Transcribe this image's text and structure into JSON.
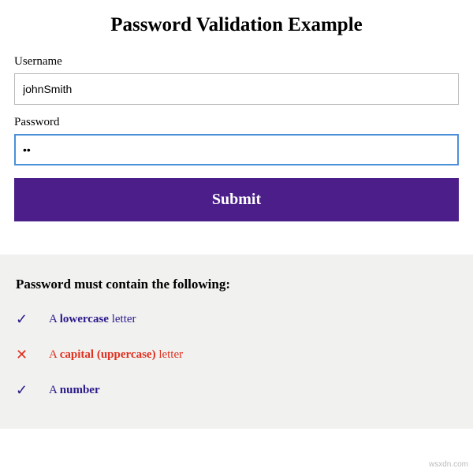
{
  "title": "Password Validation Example",
  "form": {
    "username_label": "Username",
    "username_value": "johnSmith",
    "password_label": "Password",
    "password_value": "••",
    "submit_label": "Submit"
  },
  "requirements": {
    "heading": "Password must contain the following:",
    "items": [
      {
        "icon": "✓",
        "prefix": "A ",
        "bold": "lowercase",
        "suffix": " letter",
        "valid": true
      },
      {
        "icon": "✕",
        "prefix": "A ",
        "bold": "capital (uppercase)",
        "suffix": " letter",
        "valid": false
      },
      {
        "icon": "✓",
        "prefix": "A ",
        "bold": "number",
        "suffix": "",
        "valid": true
      }
    ]
  },
  "watermark": "wsxdn.com"
}
